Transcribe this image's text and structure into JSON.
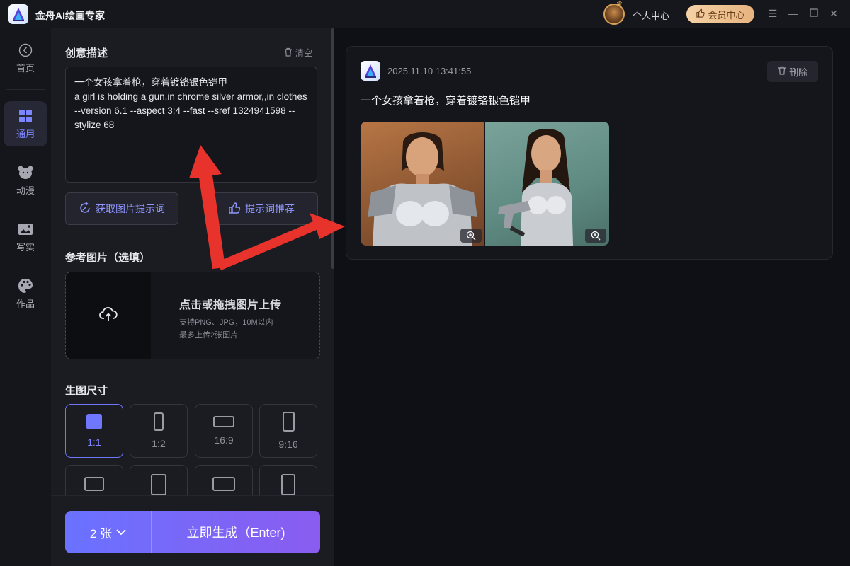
{
  "app": {
    "title": "金舟AI绘画专家"
  },
  "header": {
    "user_center": "个人中心",
    "vip_label": "会员中心"
  },
  "nav": {
    "items": [
      {
        "label": "首页",
        "icon": "back-circle-icon"
      },
      {
        "label": "通用",
        "icon": "grid-icon",
        "active": true
      },
      {
        "label": "动漫",
        "icon": "bear-icon"
      },
      {
        "label": "写实",
        "icon": "image-icon"
      },
      {
        "label": "作品",
        "icon": "palette-icon"
      }
    ]
  },
  "panel": {
    "prompt_title": "创意描述",
    "clear_label": "清空",
    "prompt_text": "一个女孩拿着枪，穿着镀铬银色铠甲\na girl is holding a gun,in chrome silver armor,,in clothes --version 6.1 --aspect 3:4 --fast --sref 1324941598 --stylize 68",
    "get_prompt_btn": "获取图片提示词",
    "recommend_btn": "提示词推荐",
    "ref_title": "参考图片（选填）",
    "upload_title": "点击或拖拽图片上传",
    "upload_hint1": "支持PNG、JPG，10M以内",
    "upload_hint2": "最多上传2张图片",
    "size_title": "生图尺寸",
    "sizes": [
      "1:1",
      "1:2",
      "16:9",
      "9:16"
    ],
    "selected_size": "1:1"
  },
  "generate": {
    "count": "2 张",
    "label": "立即生成（Enter)"
  },
  "result": {
    "time": "2025.11.10 13:41:55",
    "delete_label": "删除",
    "prompt": "一个女孩拿着枪，穿着镀铬银色铠甲"
  },
  "colors": {
    "accent": "#6f77ff",
    "vip": "#f5d2a6",
    "arrow": "#e8332c"
  }
}
